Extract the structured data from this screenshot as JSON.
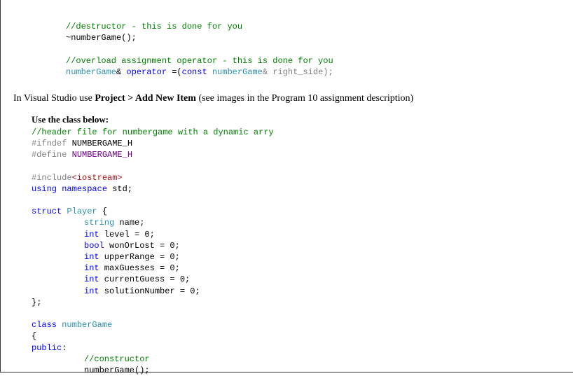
{
  "top_code": {
    "c1": "//destructor - this is done for you",
    "l1_name": "~numberGame();",
    "c2": "//overload assignment operator - this is done for you",
    "l2_ret": "numberGame",
    "l2_amp1": "& ",
    "l2_op": "operator",
    "l2_eq": " =(",
    "l2_const": "const",
    "l2_sp": " ",
    "l2_type": "numberGame",
    "l2_amp2": "& right_side);"
  },
  "narrative": {
    "prefix": "In Visual Studio use ",
    "bold": "Project > Add New Item",
    "suffix": "  (see images in the Program 10 assignment description)"
  },
  "subhead": "Use the class  below:",
  "main_code": {
    "c1": "//header file for numbergame with a dynamic arry",
    "ifndef_kw": "#ifndef",
    "ifndef_name": " NUMBERGAME_H",
    "define_kw": "#define",
    "define_name": " ",
    "define_macro": "NUMBERGAME_H",
    "include_kw": "#include",
    "include_val": "<iostream>",
    "using_kw": "using",
    "using_ns": " namespace",
    "using_std": " std;",
    "struct_kw": "struct",
    "struct_name": " Player",
    "struct_brace": " {",
    "m1_t": "string",
    "m1_r": " name;",
    "m2_t": "int",
    "m2_r": " level = 0;",
    "m3_t": "bool",
    "m3_r": " wonOrLost = 0;",
    "m4_t": "int",
    "m4_r": " upperRange = 0;",
    "m5_t": "int",
    "m5_r": " maxGuesses = 0;",
    "m6_t": "int",
    "m6_r": " currentGuess = 0;",
    "m7_t": "int",
    "m7_r": " solutionNumber = 0;",
    "struct_close": "};",
    "class_kw": "class",
    "class_name": " numberGame",
    "class_open": "{",
    "public_kw": "public",
    "public_colon": ":",
    "ctor_comment": "//constructor",
    "ctor_line": "numberGame();"
  }
}
